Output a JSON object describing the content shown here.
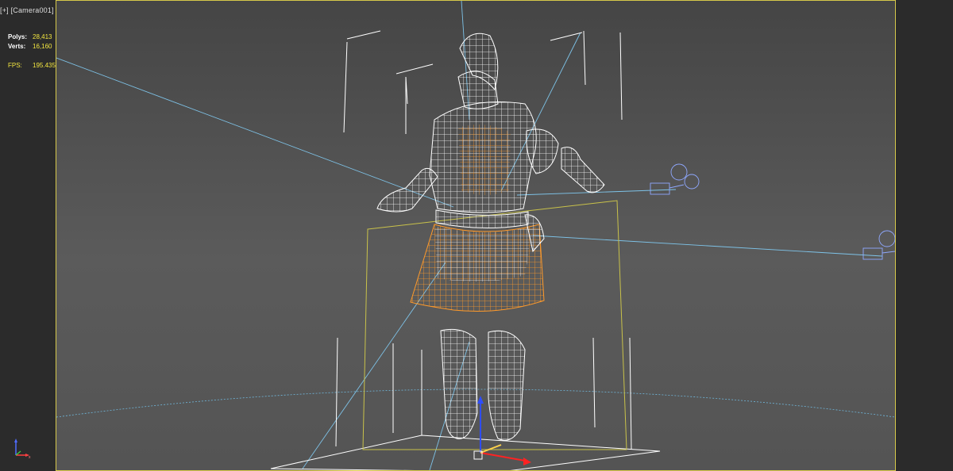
{
  "viewport": {
    "label_plus": "[+]",
    "label_camera": "[Camera001]"
  },
  "stats": {
    "polys_label": "Polys:",
    "polys_value": "28,413",
    "verts_label": "Verts:",
    "verts_value": "16,160",
    "fps_label": "FPS:",
    "fps_value": "195.435"
  },
  "colors": {
    "viewport_border": "#d6c84a",
    "stat_value": "#f3e640",
    "wireframe": "#ffffff",
    "wireframe_selected": "#ff9a2a",
    "bounding_box": "#c9c24a",
    "light_line": "#7ec3e8"
  },
  "icons": [
    "view-axis-gizmo-icon",
    "transform-gizmo-icon"
  ]
}
